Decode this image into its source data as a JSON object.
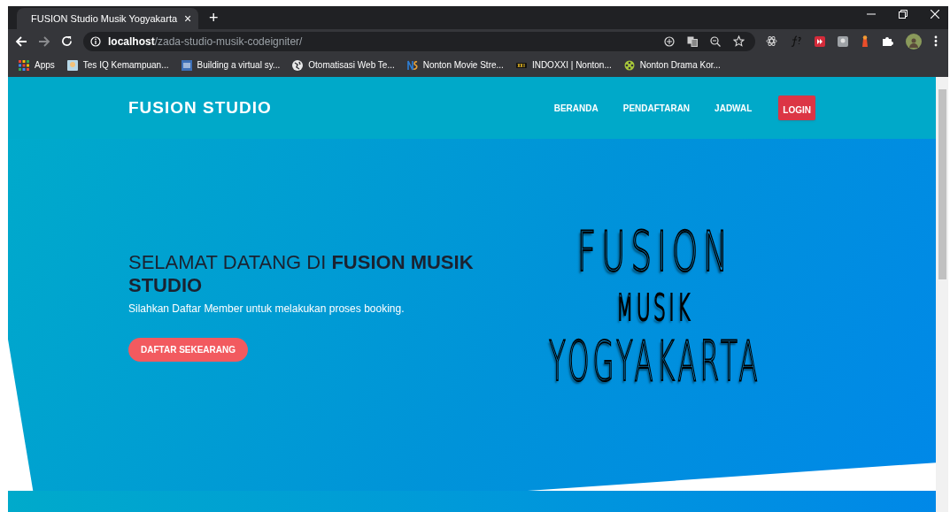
{
  "browser": {
    "tab": {
      "title": "FUSION Studio Musik Yogyakarta",
      "close": "×"
    },
    "new_tab": "+",
    "address": {
      "host": "localhost",
      "path": "/zada-studio-musik-codeigniter/"
    },
    "bookmarks": [
      {
        "label": "Apps"
      },
      {
        "label": "Tes IQ Kemampuan..."
      },
      {
        "label": "Building a virtual sy..."
      },
      {
        "label": "Otomatisasi Web Te..."
      },
      {
        "label": "Nonton Movie Stre..."
      },
      {
        "label": "INDOXXI | Nonton..."
      },
      {
        "label": "Nonton Drama Kor..."
      }
    ]
  },
  "navbar": {
    "brand": "FUSION STUDIO",
    "links": [
      {
        "label": "BERANDA",
        "kind": "link"
      },
      {
        "label": "PENDAFTARAN",
        "kind": "link"
      },
      {
        "label": "JADWAL",
        "kind": "link"
      },
      {
        "label": "LOGIN",
        "kind": "button"
      }
    ]
  },
  "hero": {
    "heading": "SELAMAT DATANG DI **FUSION MUSIK STUDIO**",
    "subtitle": "Silahkan Daftar Member untuk melakukan proses booking.",
    "button": "DAFTAR SEKEARANG",
    "logo_lines": [
      "FUSION",
      "MUSIK",
      "YOGYAKARTA"
    ]
  }
}
